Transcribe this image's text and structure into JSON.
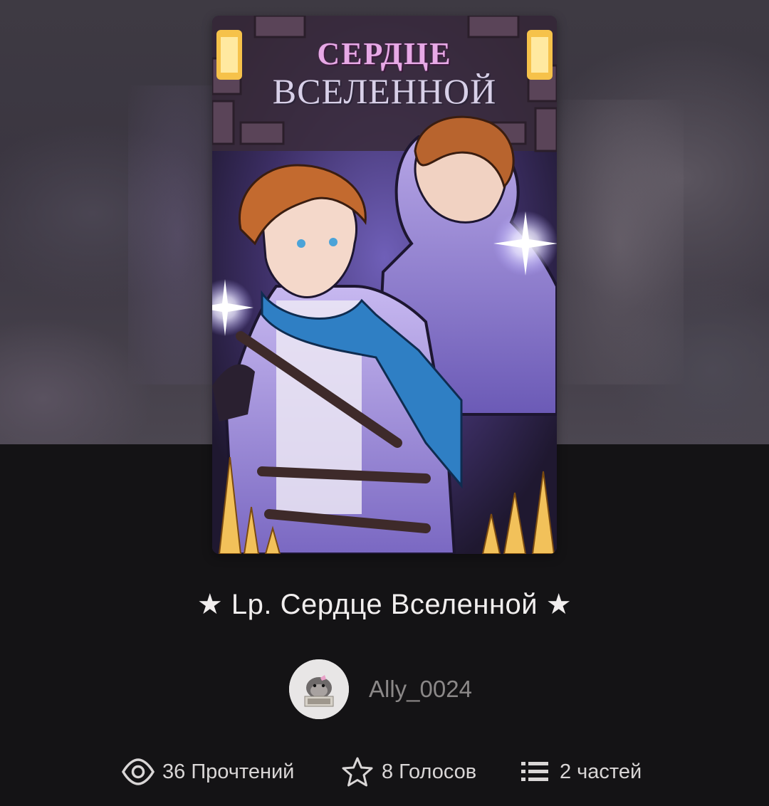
{
  "cover": {
    "title_line1": "СЕРДЦЕ",
    "title_line2": "ВСЕЛЕННОЙ"
  },
  "story": {
    "title": "★ Lp. Сердце Вселенной ★"
  },
  "author": {
    "name": "Ally_0024"
  },
  "stats": {
    "reads": "36 Прочтений",
    "votes": "8 Голосов",
    "parts": "2 частей"
  },
  "icons": {
    "reads": "eye-icon",
    "votes": "star-icon",
    "parts": "list-icon"
  },
  "colors": {
    "background": "#141315",
    "title_text": "#f1eeee",
    "author_text": "#8b8888",
    "stat_text": "#d9d6d6"
  }
}
